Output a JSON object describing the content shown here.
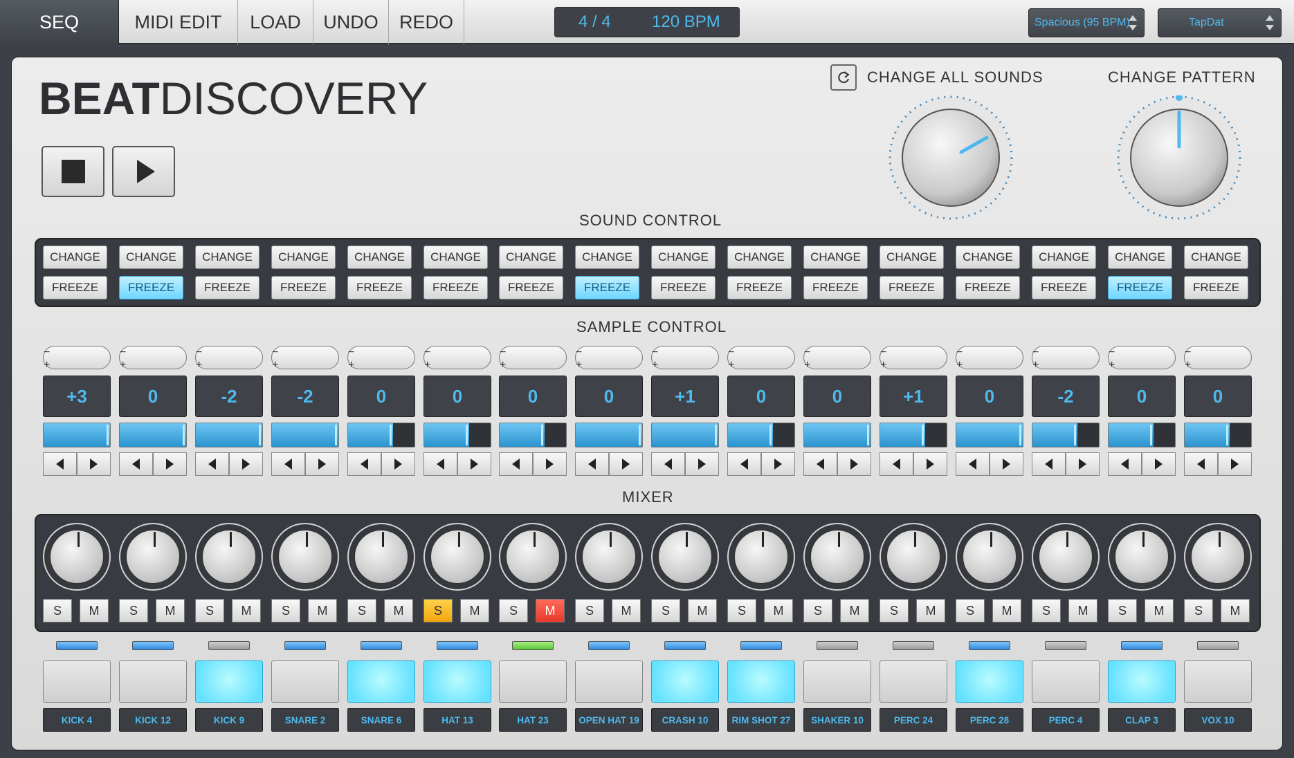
{
  "topbar": {
    "tabs": [
      "SEQ",
      "MIDI EDIT",
      "LOAD",
      "UNDO",
      "REDO"
    ],
    "time_signature": "4 / 4",
    "bpm": "120 BPM",
    "style_select": "Spacious (95 BPM)",
    "kit_select": "TapDat"
  },
  "header": {
    "logo_bold": "BEAT",
    "logo_light": "DISCOVERY",
    "change_all_sounds": "CHANGE ALL SOUNDS",
    "change_pattern": "CHANGE PATTERN",
    "icons": [
      "stop-icon",
      "play-icon",
      "refresh-icon"
    ]
  },
  "sections": {
    "sound_control": "SOUND CONTROL",
    "sample_control": "SAMPLE CONTROL",
    "mixer": "MIXER"
  },
  "sound_control": {
    "change_label": "CHANGE",
    "freeze_label": "FREEZE",
    "freeze_on": [
      false,
      true,
      false,
      false,
      false,
      false,
      false,
      true,
      false,
      false,
      false,
      false,
      false,
      false,
      true,
      false
    ]
  },
  "sample_control": {
    "minus": "−",
    "plus": "+",
    "values": [
      "+3",
      "0",
      "-2",
      "-2",
      "0",
      "0",
      "0",
      "0",
      "+1",
      "0",
      "0",
      "+1",
      "0",
      "-2",
      "0",
      "0"
    ],
    "levels": [
      1.0,
      1.0,
      1.0,
      1.0,
      0.68,
      0.68,
      0.68,
      1.0,
      1.0,
      0.68,
      1.0,
      0.68,
      1.0,
      0.68,
      0.68,
      0.68
    ]
  },
  "mixer": {
    "solo_label": "S",
    "mute_label": "M",
    "solo_on": [
      false,
      false,
      false,
      false,
      false,
      true,
      false,
      false,
      false,
      false,
      false,
      false,
      false,
      false,
      false,
      false
    ],
    "mute_on": [
      false,
      false,
      false,
      false,
      false,
      false,
      true,
      false,
      false,
      false,
      false,
      false,
      false,
      false,
      false,
      false
    ]
  },
  "pads": {
    "led_states": [
      "blue",
      "blue",
      "gray",
      "blue",
      "blue",
      "blue",
      "green",
      "blue",
      "blue",
      "blue",
      "gray",
      "gray",
      "blue",
      "gray",
      "blue",
      "gray"
    ],
    "lit": [
      false,
      false,
      true,
      false,
      true,
      true,
      false,
      false,
      true,
      true,
      false,
      false,
      true,
      false,
      true,
      false
    ],
    "labels": [
      "KICK 4",
      "KICK 12",
      "KICK 9",
      "SNARE 2",
      "SNARE 6",
      "HAT 13",
      "HAT 23",
      "OPEN HAT 19",
      "CRASH 10",
      "RIM SHOT 27",
      "SHAKER 10",
      "PERC 24",
      "PERC 28",
      "PERC 4",
      "CLAP 3",
      "VOX 10"
    ]
  },
  "colors": {
    "accent": "#4fb9ee",
    "freeze_on": "#6fd6ff",
    "solo": "#f2a50e",
    "mute": "#e8392a",
    "led_green": "#5bc63b"
  }
}
